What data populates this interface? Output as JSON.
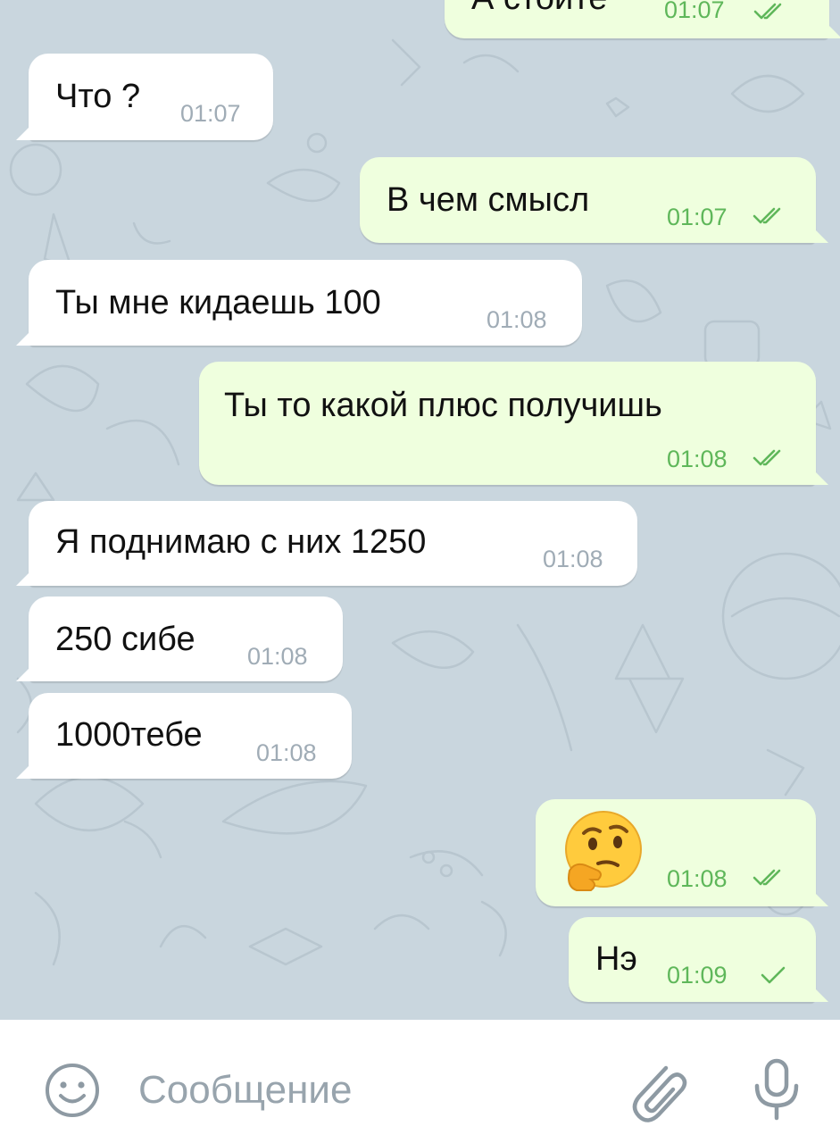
{
  "messages": [
    {
      "id": "m0",
      "dir": "out",
      "text": "А стоите",
      "time": "01:07",
      "status": "read"
    },
    {
      "id": "m1",
      "dir": "in",
      "text": "Что ?",
      "time": "01:07"
    },
    {
      "id": "m2",
      "dir": "out",
      "text": "В чем смысл",
      "time": "01:07",
      "status": "read"
    },
    {
      "id": "m3",
      "dir": "in",
      "text": "Ты мне кидаешь 100",
      "time": "01:08"
    },
    {
      "id": "m4",
      "dir": "out",
      "text": "Ты то какой плюс получишь",
      "time": "01:08",
      "status": "read"
    },
    {
      "id": "m5",
      "dir": "in",
      "text": "Я поднимаю с них 1250",
      "time": "01:08"
    },
    {
      "id": "m6",
      "dir": "in",
      "text": "250 сибе",
      "time": "01:08"
    },
    {
      "id": "m7",
      "dir": "in",
      "text": "1000тебе",
      "time": "01:08"
    },
    {
      "id": "m8",
      "dir": "out",
      "emoji": "thinking-face",
      "time": "01:08",
      "status": "read"
    },
    {
      "id": "m9",
      "dir": "out",
      "text": "Нэ",
      "time": "01:09",
      "status": "sent"
    }
  ],
  "composer": {
    "placeholder": "Сообщение",
    "icons": [
      "emoji-icon",
      "attach-icon",
      "microphone-icon"
    ]
  },
  "colors": {
    "chat_background": "#c9d6de",
    "incoming_bubble": "#ffffff",
    "outgoing_bubble": "#efffde",
    "outgoing_time": "#5fb75a",
    "incoming_time": "#a0acb6"
  }
}
